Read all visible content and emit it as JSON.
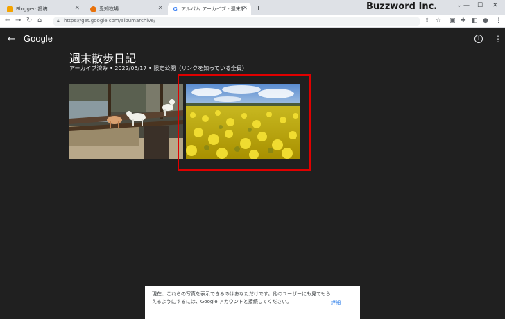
{
  "browser": {
    "tabs": [
      {
        "label": "Blogger: 投稿",
        "favicon_color": "#f4a300"
      },
      {
        "label": "愛知牧場",
        "favicon_color": "#e8710a"
      },
      {
        "label": "アルバム アーカイブ - 週末散歩日記",
        "favicon_color": "#4285f4"
      }
    ],
    "new_tab_icon": "+",
    "brand": "Buzzword Inc.",
    "url": "https://get.google.com/albumarchive/",
    "window_controls": [
      "minimize-icon",
      "maximize-icon",
      "close-icon"
    ]
  },
  "header": {
    "back_icon": "←",
    "logo_text": "Google",
    "info_icon": "i",
    "more_icon": "⋮"
  },
  "album": {
    "title": "週末散歩日記",
    "meta": "アーカイブ済み • 2022/05/17 • 限定公開（リンクを知っている全員）"
  },
  "photos": [
    {
      "subject": "goats-on-wooden-fence"
    },
    {
      "subject": "rapeseed-flower-field"
    }
  ],
  "snackbar": {
    "text": "現在、これらの写真を表示できるのはあなただけです。他のユーザーにも見てもらえるようにするには、Google アカウントと接続してください。",
    "link": "詳細"
  },
  "colors": {
    "page_bg": "#202020",
    "highlight": "#e00000",
    "link": "#1a73e8"
  }
}
